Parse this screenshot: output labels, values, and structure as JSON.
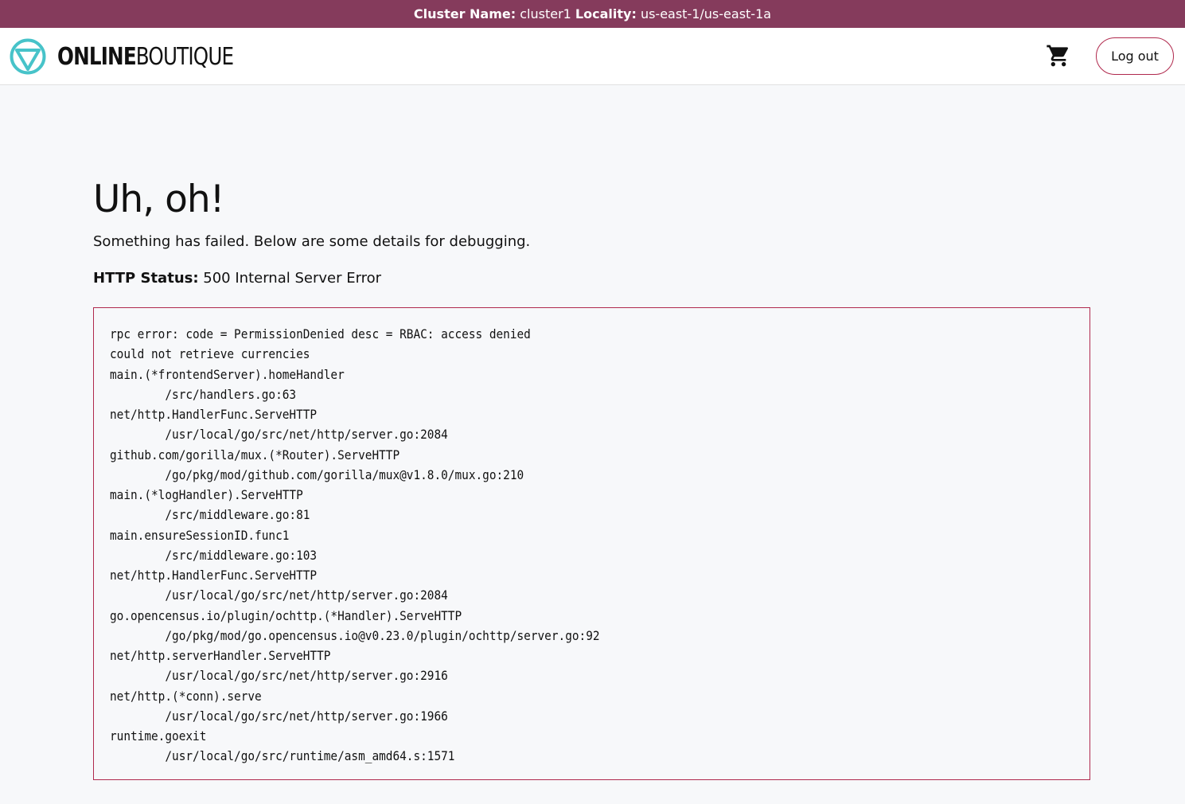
{
  "cluster_bar": {
    "cluster_label": "Cluster Name:",
    "cluster_value": "cluster1",
    "locality_label": "Locality:",
    "locality_value": "us-east-1/us-east-1a",
    "background_color": "#853b5c"
  },
  "header": {
    "logo": {
      "icon": "online-boutique-logo-icon",
      "text_strong": "ONLINE",
      "text_light": "BOUTIQUE",
      "icon_color": "#47c3c9"
    },
    "cart_icon": "shopping-cart-icon",
    "logout_label": "Log out",
    "accent_color": "#b0294d"
  },
  "main": {
    "title": "Uh, oh!",
    "subtitle": "Something has failed. Below are some details for debugging.",
    "status_label": "HTTP Status:",
    "status_value": "500 Internal Server Error",
    "error_lines": [
      "rpc error: code = PermissionDenied desc = RBAC: access denied",
      "could not retrieve currencies",
      "main.(*frontendServer).homeHandler",
      "\t/src/handlers.go:63",
      "net/http.HandlerFunc.ServeHTTP",
      "\t/usr/local/go/src/net/http/server.go:2084",
      "github.com/gorilla/mux.(*Router).ServeHTTP",
      "\t/go/pkg/mod/github.com/gorilla/mux@v1.8.0/mux.go:210",
      "main.(*logHandler).ServeHTTP",
      "\t/src/middleware.go:81",
      "main.ensureSessionID.func1",
      "\t/src/middleware.go:103",
      "net/http.HandlerFunc.ServeHTTP",
      "\t/usr/local/go/src/net/http/server.go:2084",
      "go.opencensus.io/plugin/ochttp.(*Handler).ServeHTTP",
      "\t/go/pkg/mod/go.opencensus.io@v0.23.0/plugin/ochttp/server.go:92",
      "net/http.serverHandler.ServeHTTP",
      "\t/usr/local/go/src/net/http/server.go:2916",
      "net/http.(*conn).serve",
      "\t/usr/local/go/src/net/http/server.go:1966",
      "runtime.goexit",
      "\t/usr/local/go/src/runtime/asm_amd64.s:1571"
    ]
  }
}
